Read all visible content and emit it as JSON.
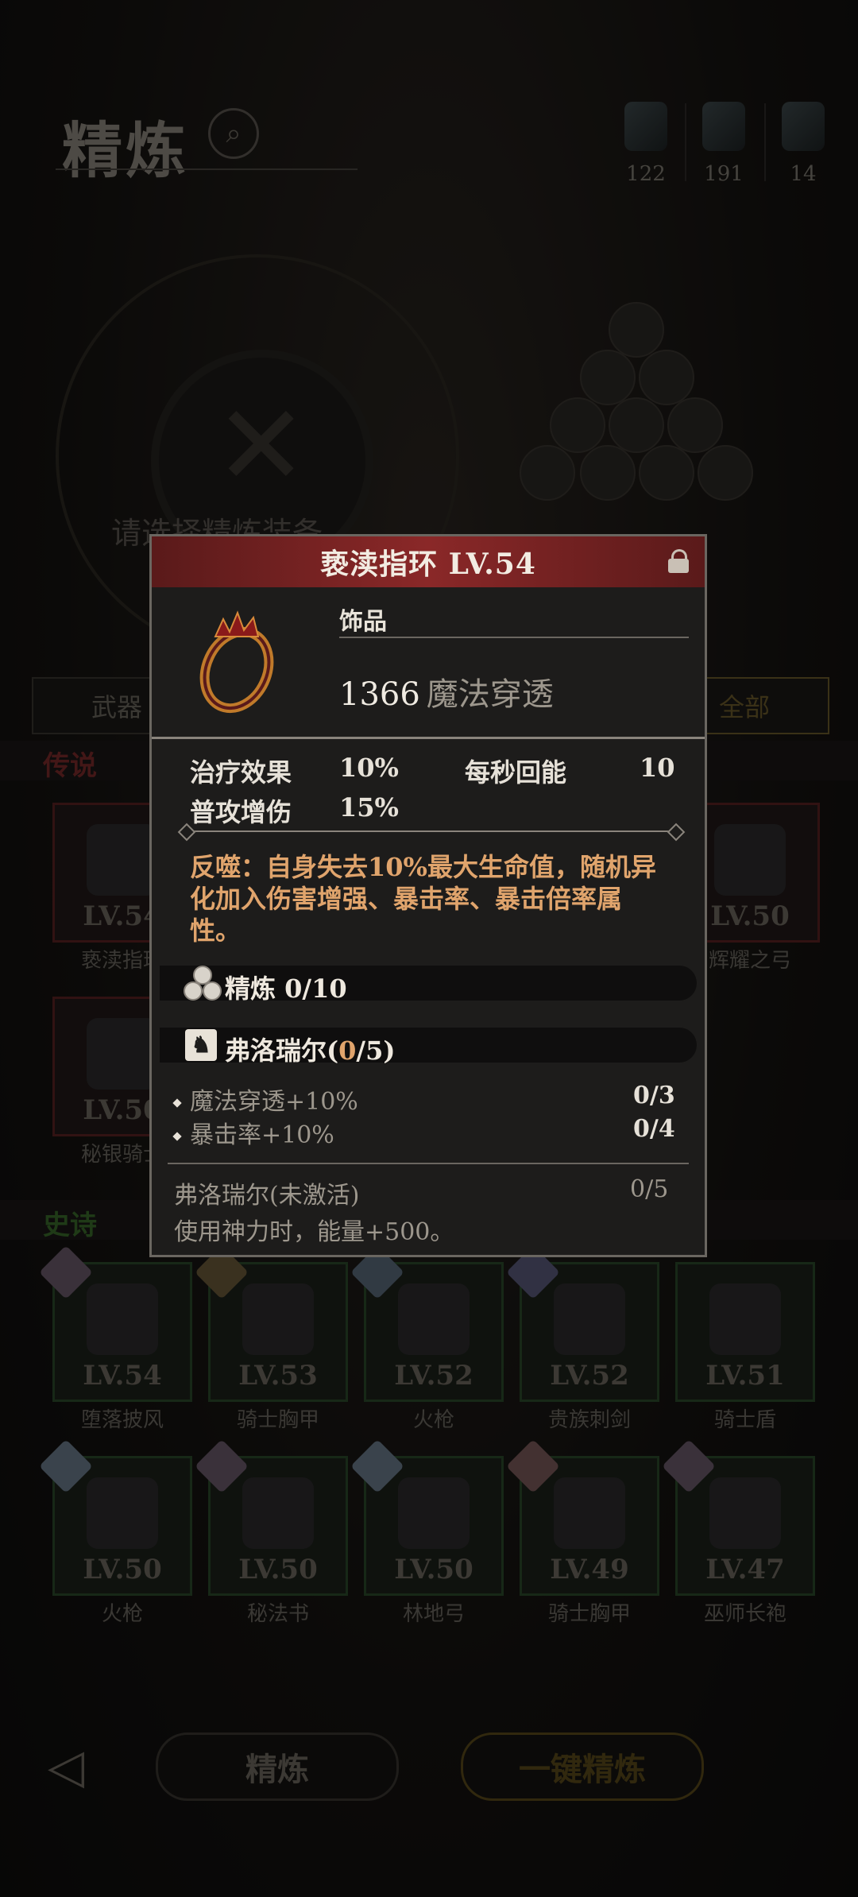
{
  "background": {
    "page_title": "精炼",
    "resources": [
      {
        "name": "resource-1",
        "count": "122"
      },
      {
        "name": "resource-2",
        "count": "191"
      },
      {
        "name": "resource-3",
        "count": "14"
      }
    ],
    "hint": "请选择精炼装备",
    "tabs": [
      "武器",
      "全部"
    ],
    "sections": {
      "legend": "传说",
      "epic": "史诗"
    },
    "legend_items": [
      {
        "level": "LV.54",
        "name": "亵渎指环"
      },
      {
        "level": "LV.50",
        "name": "辉耀之弓"
      },
      {
        "level": "LV.50",
        "name": "秘银骑士"
      }
    ],
    "epic_row1": [
      {
        "level": "LV.54",
        "name": "堕落披风"
      },
      {
        "level": "LV.53",
        "name": "骑士胸甲"
      },
      {
        "level": "LV.52",
        "name": "火枪"
      },
      {
        "level": "LV.52",
        "name": "贵族刺剑"
      },
      {
        "level": "LV.51",
        "name": "骑士盾"
      }
    ],
    "epic_row2": [
      {
        "level": "LV.50",
        "name": "火枪"
      },
      {
        "level": "LV.50",
        "name": "秘法书"
      },
      {
        "level": "LV.50",
        "name": "林地弓"
      },
      {
        "level": "LV.49",
        "name": "骑士胸甲"
      },
      {
        "level": "LV.47",
        "name": "巫师长袍"
      }
    ],
    "buttons": {
      "refine": "精炼",
      "one_click_refine": "一键精炼"
    }
  },
  "popup": {
    "title": "亵渎指环 LV.54",
    "item_type": "饰品",
    "main_stat": {
      "value": "1366",
      "label": "魔法穿透"
    },
    "stats": [
      {
        "label": "治疗效果",
        "value": "10%"
      },
      {
        "label": "每秒回能",
        "value": "10"
      },
      {
        "label": "普攻增伤",
        "value": "15%"
      }
    ],
    "effect": "反噬：自身失去10%最大生命值，随机异化加入伤害增强、暴击率、暴击倍率属性。",
    "refine": "精炼 0/10",
    "set": {
      "name": "弗洛瑞尔(",
      "count": "0",
      "total": "/5)"
    },
    "set_bonuses": [
      {
        "label": "魔法穿透+10%",
        "progress": "0/3"
      },
      {
        "label": "暴击率+10%",
        "progress": "0/4"
      }
    ],
    "set_status": {
      "label": "弗洛瑞尔(未激活)",
      "progress": "0/5"
    },
    "set_effect": "使用神力时，能量+500。",
    "colors": {
      "header": "#8a2828",
      "effect_text": "#e0a46c"
    }
  }
}
